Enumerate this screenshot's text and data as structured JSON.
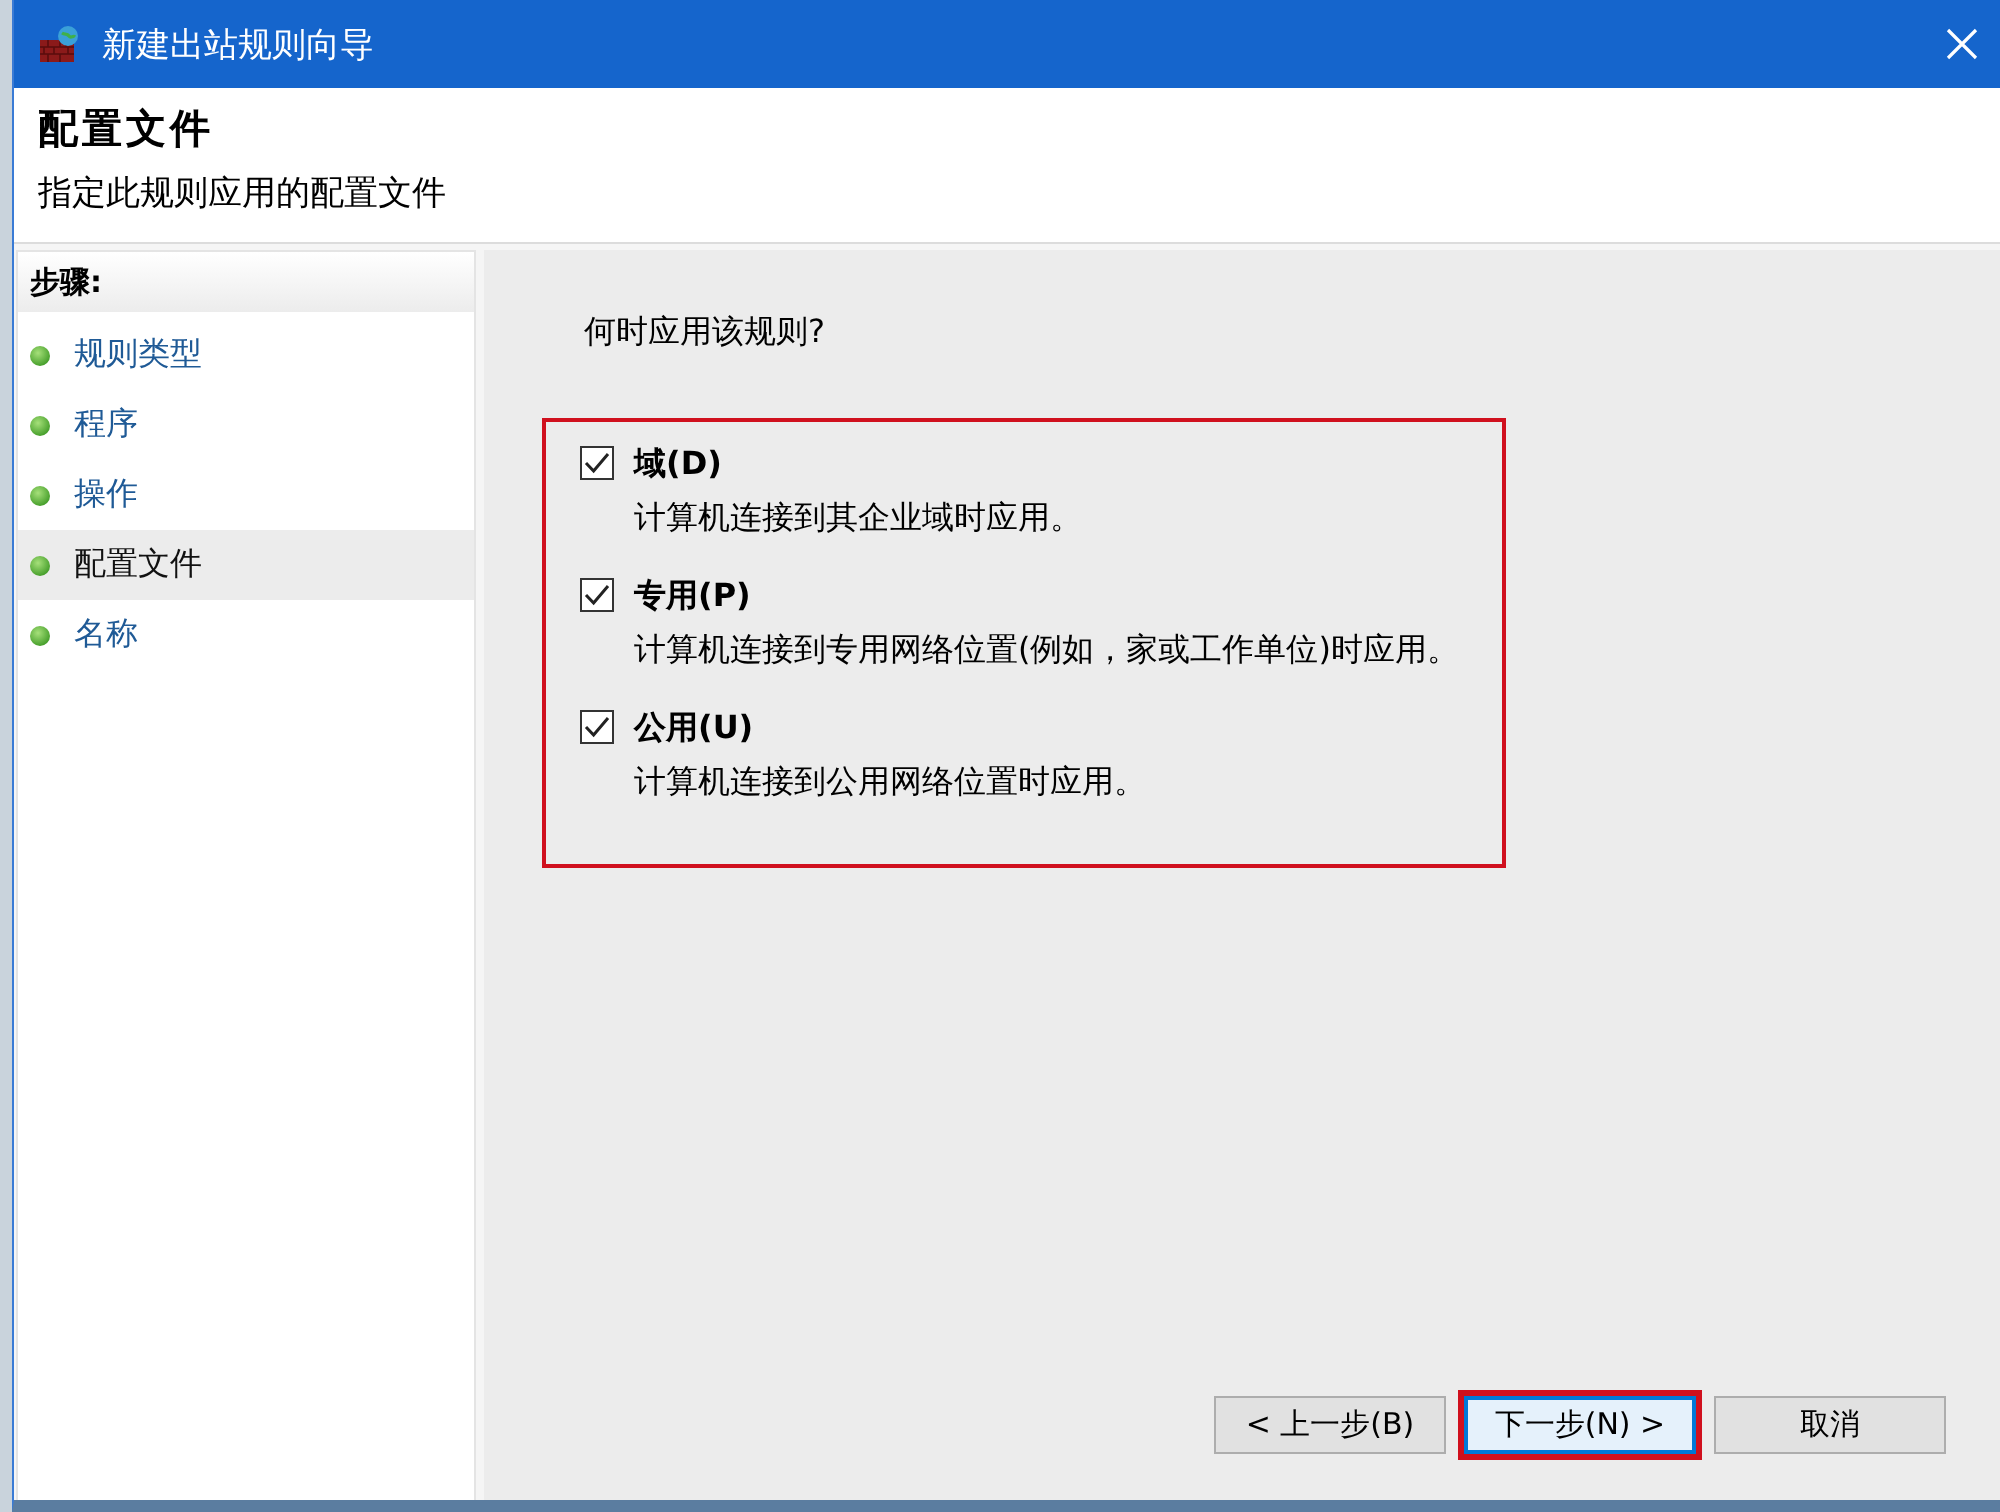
{
  "window": {
    "title": "新建出站规则向导"
  },
  "header": {
    "title": "配置文件",
    "subtitle": "指定此规则应用的配置文件"
  },
  "sidebar": {
    "heading": "步骤:",
    "items": [
      {
        "label": "规则类型",
        "selected": false
      },
      {
        "label": "程序",
        "selected": false
      },
      {
        "label": "操作",
        "selected": false
      },
      {
        "label": "配置文件",
        "selected": true
      },
      {
        "label": "名称",
        "selected": false
      }
    ]
  },
  "content": {
    "question": "何时应用该规则?",
    "highlighted": true,
    "options": [
      {
        "label": "域(D)",
        "description": "计算机连接到其企业域时应用。",
        "checked": true
      },
      {
        "label": "专用(P)",
        "description": "计算机连接到专用网络位置(例如，家或工作单位)时应用。",
        "checked": true
      },
      {
        "label": "公用(U)",
        "description": "计算机连接到公用网络位置时应用。",
        "checked": true
      }
    ]
  },
  "buttons": [
    {
      "label": "< 上一步(B)",
      "focused": false,
      "highlighted": false
    },
    {
      "label": "下一步(N) >",
      "focused": true,
      "highlighted": true
    },
    {
      "label": "取消",
      "focused": false,
      "highlighted": false
    }
  ]
}
